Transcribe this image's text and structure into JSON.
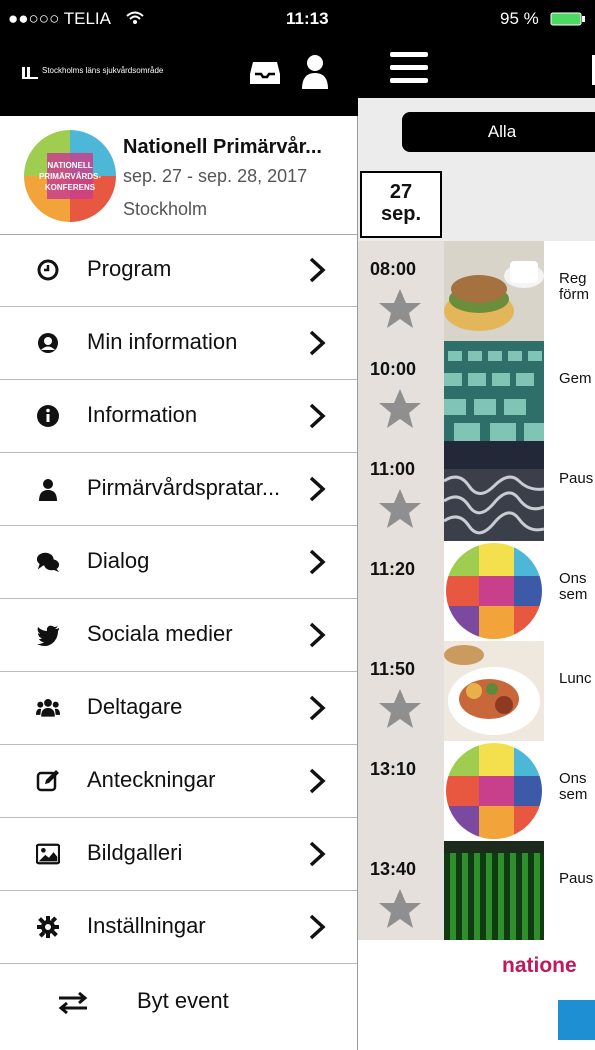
{
  "status_bar": {
    "carrier": "●●○○○ TELIA",
    "time": "11:13",
    "battery": "95 %"
  },
  "header": {
    "logo_text": "Stockholms läns sjukvårdsområde"
  },
  "event": {
    "title": "Nationell Primärvår...",
    "dates": "sep. 27 - sep. 28, 2017",
    "place": "Stockholm",
    "logo_text": "NATIONELL PRIMÄRVÅRDS-KONFERENS"
  },
  "menu": {
    "items": [
      {
        "label": "Program",
        "icon": "clock-icon"
      },
      {
        "label": "Min information",
        "icon": "user-circle-icon"
      },
      {
        "label": "Information",
        "icon": "info-icon"
      },
      {
        "label": "Pirmärvårdspratar...",
        "icon": "person-icon"
      },
      {
        "label": "Dialog",
        "icon": "chat-icon"
      },
      {
        "label": "Sociala medier",
        "icon": "twitter-icon"
      },
      {
        "label": "Deltagare",
        "icon": "group-icon"
      },
      {
        "label": "Anteckningar",
        "icon": "edit-icon"
      },
      {
        "label": "Bildgalleri",
        "icon": "image-icon"
      },
      {
        "label": "Inställningar",
        "icon": "gear-icon"
      }
    ],
    "switch_label": "Byt event"
  },
  "schedule": {
    "filter_label": "Alla",
    "date_day": "27",
    "date_month": "sep.",
    "sessions": [
      {
        "time": "08:00",
        "title_line1": "Reg",
        "title_line2": "förm",
        "thumb": "food"
      },
      {
        "time": "10:00",
        "title_line1": "Gem",
        "title_line2": "",
        "thumb": "chairs"
      },
      {
        "time": "11:00",
        "title_line1": "Paus",
        "title_line2": "",
        "thumb": "metal"
      },
      {
        "time": "11:20",
        "title_line1": "Ons",
        "title_line2": "sem",
        "thumb": "logo"
      },
      {
        "time": "11:50",
        "title_line1": "Lunc",
        "title_line2": "",
        "thumb": "food"
      },
      {
        "time": "13:10",
        "title_line1": "Ons",
        "title_line2": "sem",
        "thumb": "logo"
      },
      {
        "time": "13:40",
        "title_line1": "Paus",
        "title_line2": "",
        "thumb": "curtain"
      }
    ],
    "footer_word": "natione"
  },
  "colors": {
    "accent": "#c2185b",
    "blue": "#1f8fd3",
    "time_column": "#e6e0dc"
  }
}
